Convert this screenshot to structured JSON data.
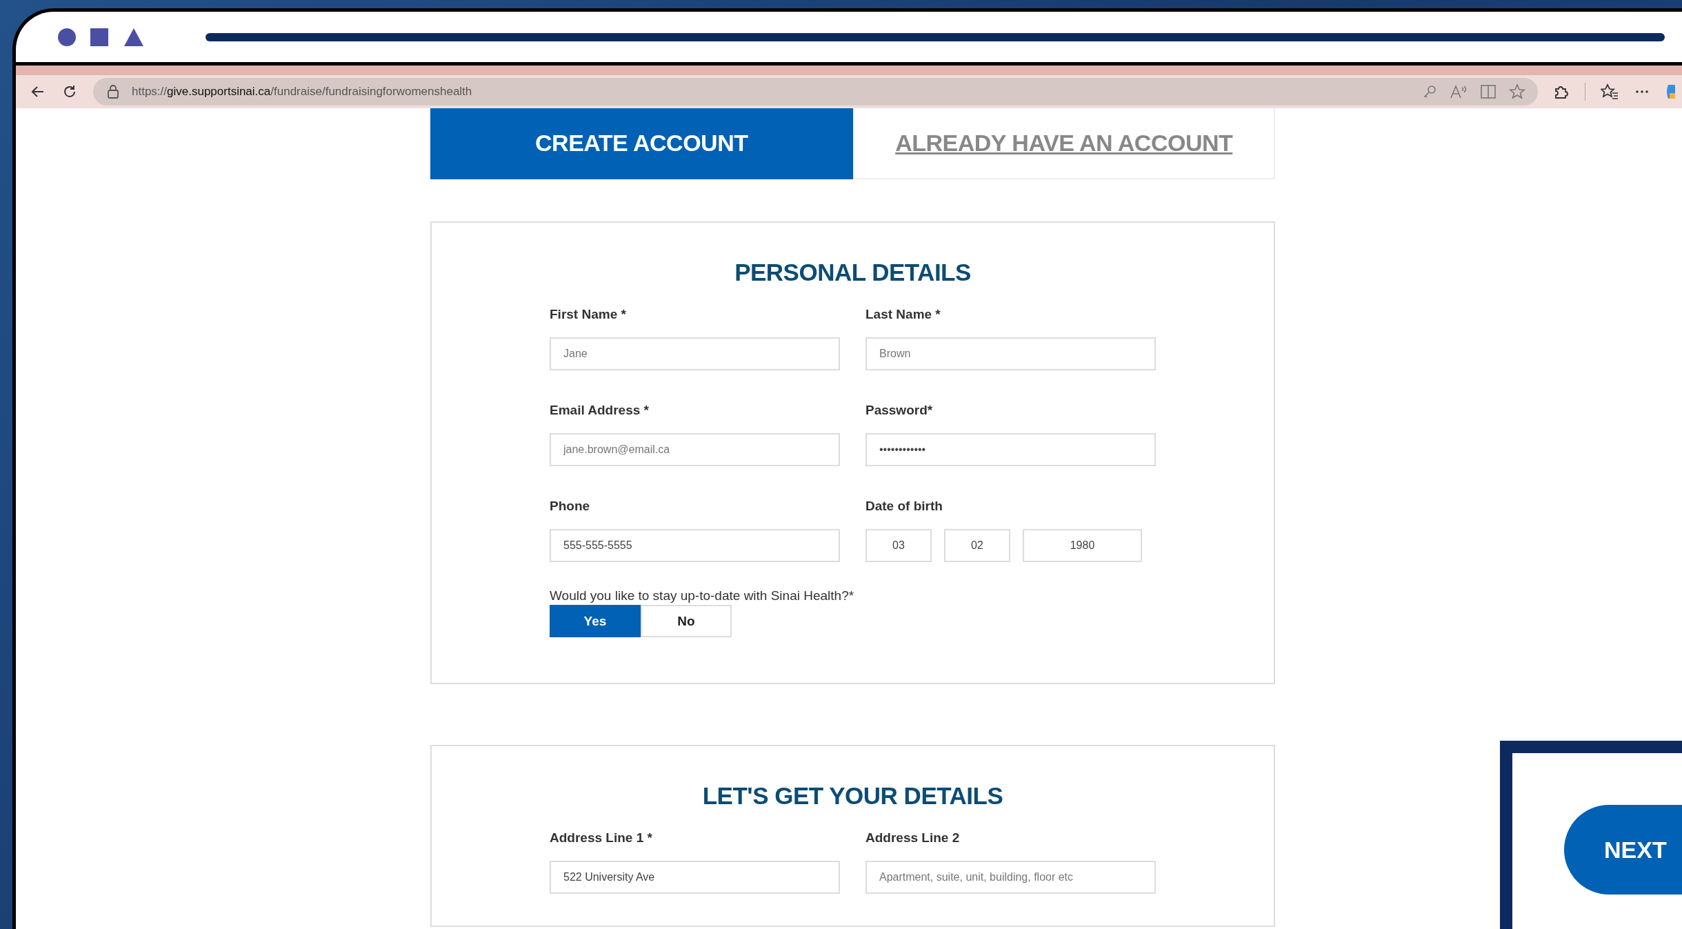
{
  "browser": {
    "url_scheme": "https://",
    "url_domain": "give.supportsinai.ca",
    "url_path": "/fundraise/fundraisingforwomenshealth"
  },
  "tabs": [
    {
      "label": "CREATE ACCOUNT",
      "selected": true
    },
    {
      "label": "ALREADY HAVE AN ACCOUNT",
      "selected": false
    }
  ],
  "sections": [
    {
      "title": "PERSONAL DETAILS",
      "rows": [
        [
          {
            "label": "First Name *",
            "fields": [
              {
                "placeholder": "Jane"
              }
            ]
          },
          {
            "label": "Last Name *",
            "fields": [
              {
                "placeholder": "Brown"
              }
            ]
          }
        ],
        [
          {
            "label": "Email Address *",
            "fields": [
              {
                "placeholder": "jane.brown@email.ca"
              }
            ]
          },
          {
            "label": "Password*",
            "fields": [
              {
                "value": "••••••••••••"
              }
            ]
          }
        ],
        [
          {
            "label": "Phone",
            "fields": [
              {
                "value": "555-555-5555"
              }
            ]
          },
          {
            "label": "Date of birth",
            "kind": "date",
            "fields": [
              {
                "value": "03"
              },
              {
                "value": "02"
              },
              {
                "value": "1980"
              }
            ]
          }
        ]
      ],
      "question": {
        "label": "Would you like to stay up-to-date with Sinai Health?*",
        "options": [
          {
            "label": "Yes",
            "selected": true
          },
          {
            "label": "No",
            "selected": false
          }
        ]
      }
    },
    {
      "title": "LET'S GET YOUR DETAILS",
      "rows": [
        [
          {
            "label": "Address Line 1 *",
            "fields": [
              {
                "value": "522 University Ave"
              }
            ]
          },
          {
            "label": "Address Line 2",
            "fields": [
              {
                "placeholder": "Apartment, suite, unit, building, floor etc"
              }
            ]
          }
        ]
      ]
    }
  ],
  "next_button": {
    "label": "NEXT"
  }
}
